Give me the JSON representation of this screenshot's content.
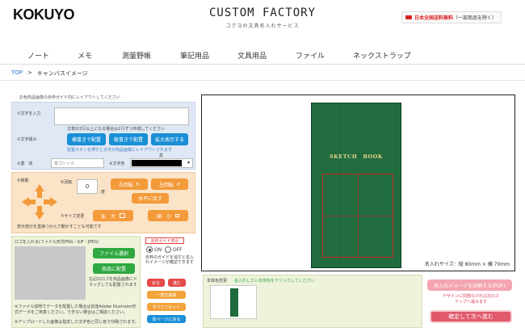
{
  "header": {
    "logo": "KOKUYO",
    "brand_title": "CUSTOM FACTORY",
    "brand_subtitle": "コクヨの文具名入れサービス",
    "shipping_red": "日本全国送料無料",
    "shipping_rest": "（一部商品を除く）"
  },
  "nav": {
    "items": [
      "ノート",
      "メモ",
      "測量野帳",
      "筆記用品",
      "文具用品",
      "ファイル",
      "ネックストラップ"
    ]
  },
  "breadcrumb": {
    "home": "TOP",
    "separator": ">",
    "current": "キャンバスイメージ"
  },
  "instructions": "お色商品画像の赤枠ガイド内にレイアウトしてください",
  "text_panel": {
    "input_label": "①文字を入力",
    "input_value": "",
    "note": "文章が2行以上になる場合は1行ずつ作成してください",
    "align_label": "②文字組み",
    "btn_horizontal": "横書きで配置",
    "btn_vertical": "縦書きで配置",
    "btn_enlarge": "拡大表示する",
    "align_hint": "配置ボタンを押すと文字が商品画像にレイアウトされます",
    "font_label": "③書　体",
    "font_value": "角ゴシック",
    "color_label": "④文字色",
    "color_header": "黒",
    "color_value": "#000000"
  },
  "move_panel": {
    "move_label": "⑤移動",
    "rotate_label": "⑥回転",
    "rotate_value": "0",
    "rotate_unit": "度",
    "btn_rotate_right": "右回転",
    "btn_rotate_left": "左回転",
    "btn_level": "水平に戻す",
    "size_label": "⑦サイズ変更",
    "btn_enlarge": "拡　大",
    "btn_shrink": "縮　小",
    "drag_hint": "表示部分を直接つかんで動かすことも可能です"
  },
  "logo_panel": {
    "title": "ロゴを入れる(ファイル形式PNG・GIF・JPEG)",
    "btn_select": "ファイル選択",
    "btn_place": "商品に配置",
    "place_hint": "左記のロゴを商品画像にドラッグしても配置されます",
    "note1": "※ファイル説明でデータを配置した場合は別途Adobe Illustrator形式データをご用意ください。できない場合はご相談ください。",
    "note2": "※アップロードした画像は指定した文字色と同じ色で印刷されます。"
  },
  "guide": {
    "title": "赤枠ガイド表示",
    "on_label": "ON",
    "off_label": "OFF",
    "selected": "ON",
    "hint": "赤枠のガイドを消すと名入れイメージが確認できます"
  },
  "edit_buttons": {
    "back": "戻る",
    "forward": "進む",
    "delete_one": "一部を削除",
    "reset": "すべてリセット",
    "page_back": "前ページに戻る"
  },
  "canvas": {
    "notebook_title": "SKETCH　BOOK",
    "size_label": "名入れサイズ：縦 80mm × 横 70mm"
  },
  "thumbs": {
    "title": "本体色変更",
    "hint": "名入れしたい本体色をクリックしてください"
  },
  "right": {
    "btn_print": "名入れイメージを印刷する(PDF)",
    "note": "デザインに問題なければ次のステップへ進みます",
    "btn_next": "確定して次へ進む"
  },
  "colors": {
    "accent_blue": "#1a8fd6",
    "notebook_green": "#1e6a3c",
    "guide_red": "#c62828",
    "orange": "#f39a3a",
    "next_red": "#e05a6b"
  }
}
